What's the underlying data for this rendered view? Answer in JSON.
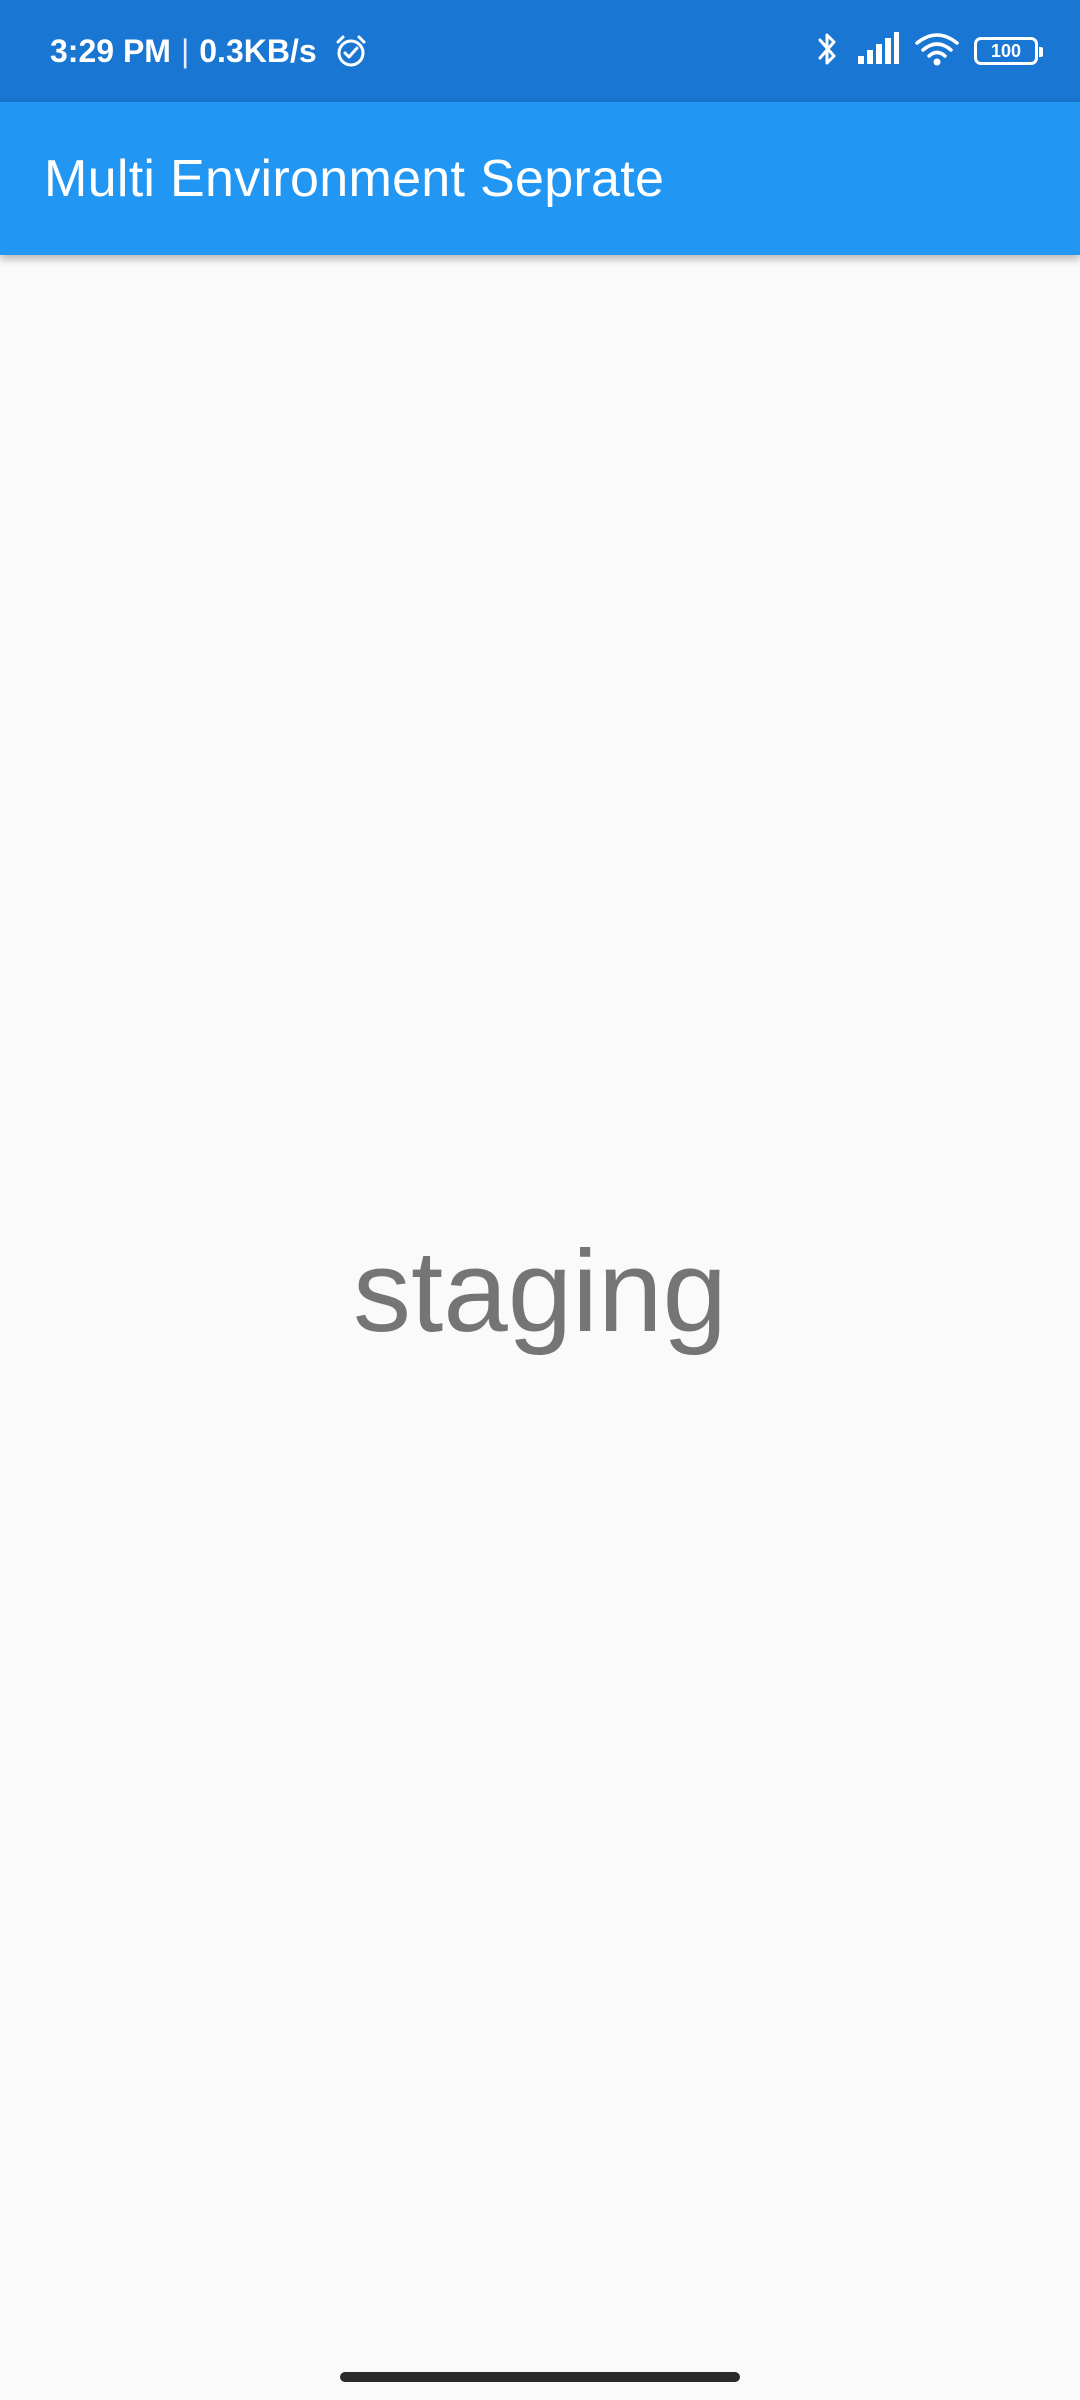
{
  "status_bar": {
    "time": "3:29 PM",
    "separator": "|",
    "network_speed": "0.3KB/s",
    "battery_level": "100",
    "icons": [
      "alarm-icon",
      "bluetooth-icon",
      "signal-icon",
      "wifi-icon",
      "battery-icon"
    ]
  },
  "app_bar": {
    "title": "Multi Environment Seprate"
  },
  "main": {
    "environment_label": "staging"
  },
  "colors": {
    "status_bar": "#1976d2",
    "app_bar": "#2196f3",
    "background": "#fafafa",
    "label_text": "#757575"
  }
}
